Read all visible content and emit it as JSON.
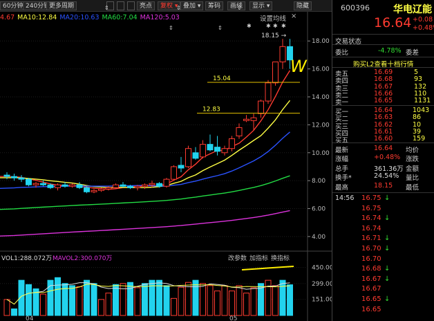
{
  "toolbar": {
    "left_labels": [
      "60分钟",
      "240分钟",
      "更多周期"
    ],
    "right_labels": [
      "亮点",
      "复权",
      "叠加",
      "筹码",
      "画线",
      "显示",
      "隐藏"
    ]
  },
  "ma_legend": [
    {
      "text": "4.67",
      "color": "#ff3b30"
    },
    {
      "text": "MA10:12.84",
      "color": "#ffff44"
    },
    {
      "text": "MA20:10.63",
      "color": "#2a52ff"
    },
    {
      "text": "MA60:7.04",
      "color": "#22dd44"
    },
    {
      "text": "MA120:5.03",
      "color": "#dd33dd"
    }
  ],
  "set_ma_label": "设置均线",
  "close_label": "×",
  "price_axis": [
    "18.00",
    "16.00",
    "14.00",
    "12.00",
    "10.00",
    "8.00",
    "6.00",
    "4.00"
  ],
  "vol_axis": [
    "450.00",
    "299.00",
    "151.00"
  ],
  "annotations": {
    "high": "18.15",
    "level1": "15.04",
    "level2": "12.83",
    "w_mark": "W"
  },
  "date_labels": [
    "04",
    "05"
  ],
  "vol_legend": {
    "vol": "VOL1:288.072万",
    "mavol": "MAVOL2:300.070万"
  },
  "vol_buttons": [
    "改参数",
    "加指标",
    "换指标"
  ],
  "stock": {
    "code": "600396",
    "name": "华电辽能",
    "price": "16.64",
    "change": "+0.08",
    "change_pct": "+0.48%"
  },
  "panel": {
    "tab": "交易状态",
    "weibi_label": "委比",
    "weibi_value": "-4.78%",
    "weicha_label": "委差",
    "buy_link": "购买L2查看十档行情",
    "asks": [
      {
        "label": "卖五",
        "price": "16.69",
        "vol": "5"
      },
      {
        "label": "卖四",
        "price": "16.68",
        "vol": "93"
      },
      {
        "label": "卖三",
        "price": "16.67",
        "vol": "132"
      },
      {
        "label": "卖二",
        "price": "16.66",
        "vol": "110"
      },
      {
        "label": "卖一",
        "price": "16.65",
        "vol": "1131"
      }
    ],
    "bids": [
      {
        "label": "买一",
        "price": "16.64",
        "vol": "1043"
      },
      {
        "label": "买二",
        "price": "16.63",
        "vol": "86"
      },
      {
        "label": "买三",
        "price": "16.62",
        "vol": "10"
      },
      {
        "label": "买四",
        "price": "16.61",
        "vol": "39"
      },
      {
        "label": "买五",
        "price": "16.60",
        "vol": "159"
      }
    ],
    "stats": [
      {
        "l": "最新",
        "v": "16.64",
        "c": "#ff3b30",
        "l2": "均价"
      },
      {
        "l": "涨幅",
        "v": "+0.48%",
        "c": "#ff3b30",
        "l2": "涨跌"
      },
      {
        "l": "总手",
        "v": "361.36万",
        "c": "#dddddd",
        "l2": "金额"
      },
      {
        "l": "换手*",
        "v": "24.54%",
        "c": "#dddddd",
        "l2": "量比"
      },
      {
        "l": "最高",
        "v": "18.15",
        "c": "#ff3b30",
        "l2": "最低"
      }
    ],
    "ticks": [
      {
        "time": "14:56",
        "price": "16.75",
        "dir": "↓"
      },
      {
        "time": "",
        "price": "16.75",
        "dir": ""
      },
      {
        "time": "",
        "price": "16.74",
        "dir": "↓"
      },
      {
        "time": "",
        "price": "16.74",
        "dir": ""
      },
      {
        "time": "",
        "price": "16.71",
        "dir": "↓"
      },
      {
        "time": "",
        "price": "16.70",
        "dir": "↓"
      },
      {
        "time": "",
        "price": "16.70",
        "dir": ""
      },
      {
        "time": "",
        "price": "16.68",
        "dir": "↓"
      },
      {
        "time": "",
        "price": "16.67",
        "dir": "↓"
      },
      {
        "time": "",
        "price": "16.67",
        "dir": ""
      },
      {
        "time": "",
        "price": "16.65",
        "dir": "↓"
      },
      {
        "time": "",
        "price": "16.65",
        "dir": ""
      }
    ]
  },
  "chart_data": {
    "type": "candlestick",
    "ylim": [
      3.5,
      19.2
    ],
    "candles": [
      [
        8.4,
        8.6,
        8.1,
        8.3
      ],
      [
        8.3,
        8.5,
        8.0,
        8.2
      ],
      [
        8.2,
        8.4,
        7.9,
        8.1
      ],
      [
        8.1,
        8.2,
        7.6,
        7.7
      ],
      [
        7.7,
        7.9,
        7.5,
        7.8
      ],
      [
        7.8,
        8.0,
        7.6,
        7.7
      ],
      [
        7.7,
        7.8,
        7.4,
        7.5
      ],
      [
        7.5,
        7.8,
        7.3,
        7.7
      ],
      [
        7.7,
        7.9,
        7.5,
        7.6
      ],
      [
        7.6,
        7.8,
        7.5,
        7.7
      ],
      [
        7.7,
        7.9,
        7.4,
        7.5
      ],
      [
        7.5,
        7.6,
        7.1,
        7.2
      ],
      [
        7.2,
        7.4,
        7.1,
        7.3
      ],
      [
        7.3,
        7.5,
        7.2,
        7.4
      ],
      [
        7.4,
        7.6,
        7.3,
        7.5
      ],
      [
        7.5,
        7.8,
        7.4,
        7.7
      ],
      [
        7.7,
        7.9,
        7.5,
        7.6
      ],
      [
        7.6,
        7.7,
        7.4,
        7.5
      ],
      [
        7.5,
        7.7,
        7.3,
        7.6
      ],
      [
        7.6,
        7.8,
        7.4,
        7.7
      ],
      [
        7.7,
        8.0,
        7.5,
        7.8
      ],
      [
        7.8,
        7.9,
        7.5,
        7.6
      ],
      [
        7.6,
        8.2,
        7.5,
        8.1
      ],
      [
        8.1,
        9.1,
        8.0,
        9.0
      ],
      [
        9.1,
        9.7,
        8.6,
        8.9
      ],
      [
        9.0,
        10.5,
        8.9,
        10.3
      ],
      [
        10.0,
        10.4,
        9.5,
        9.6
      ],
      [
        9.7,
        10.9,
        9.6,
        10.6
      ],
      [
        10.6,
        11.3,
        10.1,
        10.2
      ],
      [
        10.4,
        11.2,
        9.8,
        10.1
      ],
      [
        10.0,
        10.5,
        9.8,
        10.3
      ],
      [
        10.3,
        11.2,
        10.1,
        11.0
      ],
      [
        11.2,
        12.1,
        11.0,
        11.8
      ],
      [
        12.3,
        12.7,
        12.2,
        12.4
      ],
      [
        12.3,
        12.8,
        11.6,
        12.5
      ],
      [
        12.8,
        13.8,
        12.5,
        13.7
      ],
      [
        13.7,
        15.2,
        13.5,
        15.0
      ],
      [
        15.0,
        16.5,
        14.8,
        16.5
      ],
      [
        16.5,
        18.15,
        16.0,
        17.6
      ],
      [
        17.6,
        18.15,
        16.0,
        16.64
      ]
    ],
    "volume": [
      {
        "v": 150,
        "up": true
      },
      {
        "v": 62,
        "up": false
      },
      {
        "v": 330,
        "up": false
      },
      {
        "v": 290,
        "up": false
      },
      {
        "v": 250,
        "up": false
      },
      {
        "v": 200,
        "up": true
      },
      {
        "v": 330,
        "up": false
      },
      {
        "v": 355,
        "up": false
      },
      {
        "v": 300,
        "up": false
      },
      {
        "v": 280,
        "up": false
      },
      {
        "v": 270,
        "up": true
      },
      {
        "v": 330,
        "up": false
      },
      {
        "v": 300,
        "up": false
      },
      {
        "v": 150,
        "up": true
      },
      {
        "v": 210,
        "up": true
      },
      {
        "v": 290,
        "up": false
      },
      {
        "v": 300,
        "up": true
      },
      {
        "v": 310,
        "up": false
      },
      {
        "v": 260,
        "up": true
      },
      {
        "v": 300,
        "up": false
      },
      {
        "v": 330,
        "up": false
      },
      {
        "v": 330,
        "up": false
      },
      {
        "v": 280,
        "up": false
      },
      {
        "v": 160,
        "up": true
      },
      {
        "v": 265,
        "up": true
      },
      {
        "v": 310,
        "up": true
      },
      {
        "v": 330,
        "up": false
      },
      {
        "v": 300,
        "up": true
      },
      {
        "v": 280,
        "up": true
      },
      {
        "v": 230,
        "up": true
      },
      {
        "v": 280,
        "up": true
      },
      {
        "v": 230,
        "up": true
      },
      {
        "v": 280,
        "up": true
      },
      {
        "v": 210,
        "up": true
      },
      {
        "v": 260,
        "up": true
      },
      {
        "v": 300,
        "up": false
      },
      {
        "v": 330,
        "up": true
      },
      {
        "v": 280,
        "up": true
      },
      {
        "v": 330,
        "up": false
      },
      {
        "v": 288,
        "up": false
      }
    ],
    "vol_ylim": [
      0,
      480
    ],
    "price_levels": [
      15.04,
      12.83
    ],
    "high_label_value": 18.15
  }
}
